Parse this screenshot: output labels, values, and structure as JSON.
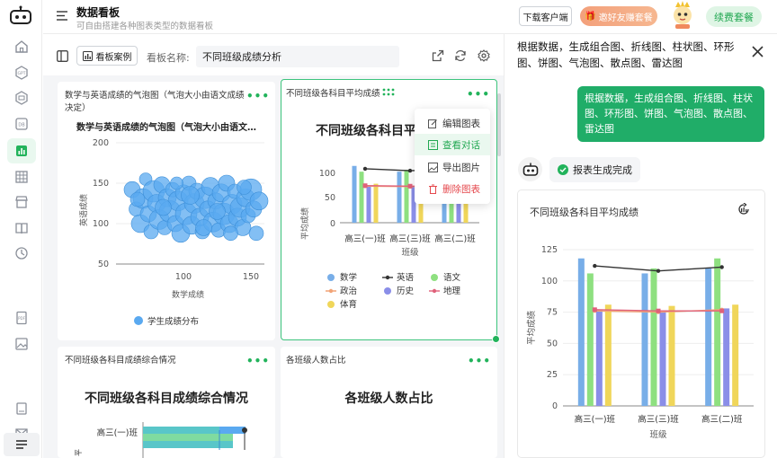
{
  "header": {
    "title": "数据看板",
    "subtitle": "可自由搭建各种图表类型的数据看板",
    "download_btn": "下载客户端",
    "invite_btn": "邀好友赚套餐",
    "renew_btn": "续费套餐"
  },
  "toolbar": {
    "case_btn": "看板案例",
    "name_label": "看板名称:",
    "name_value": "不同班级成绩分析"
  },
  "cards": {
    "bubble": {
      "header": "数学与英语成绩的气泡图（气泡大小由语文成绩决定）",
      "title": "数学与英语成绩的气泡图（气泡大小由语文…",
      "xlabel": "数学成绩",
      "ylabel": "英语成绩",
      "legend": "学生成绩分布",
      "color": "#5aa9f0"
    },
    "avg": {
      "header": "不同班级各科目平均成绩",
      "title": "不同班级各科目平",
      "xlabel": "班级",
      "ylabel": "平均成绩",
      "categories": [
        "高三(一)班",
        "高三(三)班",
        "高三(二)班"
      ],
      "ticks": [
        "100",
        "50",
        "0"
      ]
    },
    "combined": {
      "header": "不同班级各科目成绩综合情况",
      "title": "不同班级各科目成绩综合情况",
      "row_label": "高三(一)班"
    },
    "headcount": {
      "header": "各班级人数占比",
      "title": "各班级人数占比"
    }
  },
  "context_menu": {
    "edit": "编辑图表",
    "view": "查看对话",
    "export": "导出图片",
    "delete": "删除图表"
  },
  "chat": {
    "topic": "根据数据，生成组合图、折线图、柱状图、环形图、饼图、气泡图、散点图、雷达图",
    "user_message": "根据数据，生成组合图、折线图、柱状图、环形图、饼图、气泡图、散点图、雷达图",
    "status": "报表生成完成",
    "chart_title": "不同班级各科目平均成绩"
  },
  "chart_data": [
    {
      "type": "scatter",
      "title": "数学与英语成绩的气泡图（气泡大小由语文…",
      "xlabel": "数学成绩",
      "ylabel": "英语成绩",
      "xlim": [
        50,
        160
      ],
      "ylim": [
        50,
        200
      ],
      "x_ticks": [
        100,
        150
      ],
      "y_ticks": [
        50,
        100,
        150,
        200
      ],
      "series": [
        {
          "name": "学生成绩分布",
          "color": "#5aa9f0"
        }
      ],
      "points": [
        [
          62,
          142,
          9
        ],
        [
          65,
          118,
          8
        ],
        [
          68,
          100,
          10
        ],
        [
          70,
          131,
          11
        ],
        [
          72,
          155,
          7
        ],
        [
          74,
          112,
          9
        ],
        [
          76,
          90,
          8
        ],
        [
          78,
          140,
          12
        ],
        [
          80,
          125,
          10
        ],
        [
          82,
          105,
          11
        ],
        [
          84,
          148,
          9
        ],
        [
          86,
          95,
          8
        ],
        [
          88,
          132,
          10
        ],
        [
          90,
          115,
          12
        ],
        [
          92,
          142,
          8
        ],
        [
          94,
          100,
          9
        ],
        [
          96,
          128,
          11
        ],
        [
          98,
          88,
          10
        ],
        [
          100,
          138,
          9
        ],
        [
          102,
          112,
          12
        ],
        [
          104,
          150,
          8
        ],
        [
          106,
          98,
          10
        ],
        [
          108,
          125,
          11
        ],
        [
          110,
          140,
          9
        ],
        [
          112,
          108,
          10
        ],
        [
          114,
          90,
          8
        ],
        [
          116,
          132,
          12
        ],
        [
          118,
          118,
          9
        ],
        [
          120,
          146,
          10
        ],
        [
          122,
          102,
          11
        ],
        [
          124,
          128,
          9
        ],
        [
          126,
          92,
          8
        ],
        [
          128,
          138,
          10
        ],
        [
          130,
          112,
          12
        ],
        [
          132,
          150,
          9
        ],
        [
          134,
          100,
          10
        ],
        [
          136,
          124,
          11
        ],
        [
          138,
          140,
          8
        ],
        [
          140,
          108,
          10
        ],
        [
          142,
          120,
          11
        ],
        [
          144,
          95,
          9
        ],
        [
          146,
          132,
          10
        ],
        [
          148,
          110,
          8
        ],
        [
          150,
          142,
          12
        ],
        [
          152,
          118,
          9
        ],
        [
          154,
          88,
          8
        ],
        [
          156,
          128,
          10
        ],
        [
          66,
          130,
          8
        ],
        [
          85,
          120,
          9
        ],
        [
          105,
          135,
          10
        ],
        [
          125,
          115,
          9
        ],
        [
          145,
          145,
          8
        ],
        [
          95,
          150,
          7
        ],
        [
          115,
          95,
          9
        ],
        [
          135,
          88,
          8
        ]
      ]
    },
    {
      "type": "bar",
      "title": "不同班级各科目平均成绩",
      "xlabel": "班级",
      "ylabel": "平均成绩",
      "categories": [
        "高三(一)班",
        "高三(三)班",
        "高三(二)班"
      ],
      "ylim": [
        0,
        125
      ],
      "y_ticks": [
        0,
        25,
        50,
        75,
        100,
        125
      ],
      "series": [
        {
          "name": "数学",
          "kind": "bar",
          "color": "#78aee8",
          "values": [
            118,
            106,
            110
          ]
        },
        {
          "name": "语文",
          "kind": "bar",
          "color": "#8ee080",
          "values": [
            106,
            110,
            118
          ]
        },
        {
          "name": "历史",
          "kind": "bar",
          "color": "#8a8ee8",
          "values": [
            77,
            75,
            78
          ]
        },
        {
          "name": "体育",
          "kind": "bar",
          "color": "#f0d65a",
          "values": [
            81,
            80,
            81
          ]
        },
        {
          "name": "英语",
          "kind": "line",
          "color": "#333333",
          "values": [
            112,
            108,
            111
          ]
        },
        {
          "name": "政治",
          "kind": "line",
          "color": "#f2a477",
          "values": [
            76,
            75,
            77
          ]
        },
        {
          "name": "地理",
          "kind": "line",
          "color": "#e0617a",
          "values": [
            77,
            76,
            76
          ]
        }
      ],
      "legend": [
        {
          "name": "数学",
          "color": "#78aee8",
          "kind": "dot"
        },
        {
          "name": "英语",
          "color": "#333333",
          "kind": "line"
        },
        {
          "name": "语文",
          "color": "#8ee080",
          "kind": "dot"
        },
        {
          "name": "政治",
          "color": "#f2a477",
          "kind": "line"
        },
        {
          "name": "历史",
          "color": "#8a8ee8",
          "kind": "dot"
        },
        {
          "name": "地理",
          "color": "#e0617a",
          "kind": "line"
        },
        {
          "name": "体育",
          "color": "#f0d65a",
          "kind": "dot"
        }
      ]
    }
  ]
}
